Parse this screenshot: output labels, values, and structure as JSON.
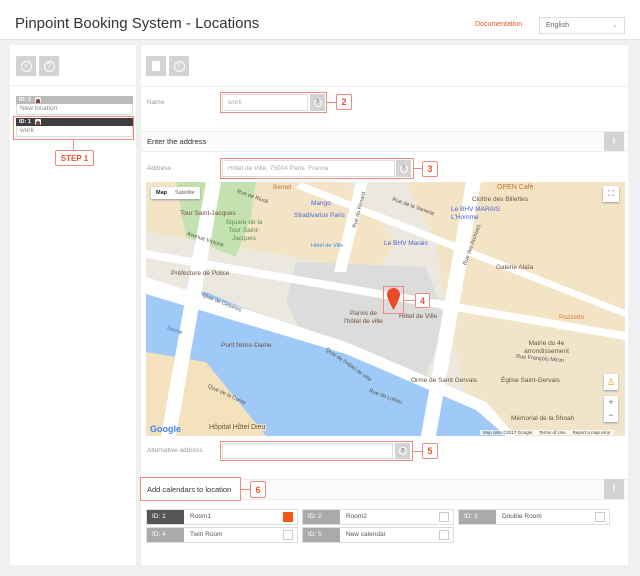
{
  "header": {
    "title": "Pinpoint Booking System - Locations",
    "documentation_link": "Documentation",
    "language": "English"
  },
  "sidebar": {
    "toolbar": {
      "add_icon": "plus-circle-icon",
      "help_icon": "question-circle-icon"
    },
    "locations": [
      {
        "id": "ID: 2",
        "name": "New location",
        "selected": false
      },
      {
        "id": "ID: 1",
        "name": "work",
        "selected": true
      }
    ],
    "step_label": "STEP 1"
  },
  "main": {
    "toolbar": {
      "delete_icon": "trash-icon",
      "help_icon": "question-circle-icon"
    },
    "name": {
      "label": "Name",
      "value": "work",
      "callout": "2"
    },
    "address_section": {
      "title": "Enter the address"
    },
    "address": {
      "label": "Address",
      "placeholder": "Hôtel de Ville, 75004 Paris, France",
      "callout": "3"
    },
    "map": {
      "types": [
        "Map",
        "Satellite"
      ],
      "marker_callout": "4",
      "labels": [
        "Benoit",
        "Tour Saint-Jacques",
        "Square de la Tour Saint-Jacques",
        "Mango",
        "Stradivarius Paris",
        "Rue de Rivoli",
        "Rue de la Verrerie",
        "Rue du Renard",
        "OPEN Café",
        "Cloître des Billettes",
        "Le BHV MARAIS L'Homme",
        "Le BHV Marais",
        "Hôtel de Ville",
        "Avenue Victoria",
        "Préfecture de Police",
        "Quai de Gesvres",
        "Seine",
        "Pont Notre-Dame",
        "Parvis de l'hôtel de ville",
        "Rue des Archives",
        "Galerie Alaïa",
        "Pozzetto",
        "Mairie du 4e arrondissement",
        "Rue François Miron",
        "Quai de l'Hôtel de ville",
        "Orme de Saint Gervais",
        "Église Saint-Gervais",
        "Quai de la Corse",
        "Rue de Lobau",
        "Mémorial de la Shoah",
        "Hôpital Hôtel Dieu"
      ],
      "attribution": "Map data ©2017 Google",
      "terms": "Terms of Use",
      "report": "Report a map error",
      "logo": "Google",
      "zoom_in": "+",
      "zoom_out": "−"
    },
    "alt_address": {
      "label": "Alternative address",
      "value": "",
      "callout": "5"
    },
    "calendars_section": {
      "title": "Add calendars to location",
      "callout": "6"
    },
    "calendars": [
      {
        "id": "ID: 1",
        "name": "Room1",
        "checked": true
      },
      {
        "id": "ID: 2",
        "name": "Room2",
        "checked": false
      },
      {
        "id": "ID: 3",
        "name": "Double Room",
        "checked": false
      },
      {
        "id": "ID: 4",
        "name": "Twin Room",
        "checked": false
      },
      {
        "id": "ID: 5",
        "name": "New calendar",
        "checked": false
      }
    ]
  },
  "colors": {
    "accent": "#e8542e",
    "callout_border": "#f08a80",
    "selected_header": "#3d3d3d",
    "button_grey": "#d3d3d3"
  }
}
